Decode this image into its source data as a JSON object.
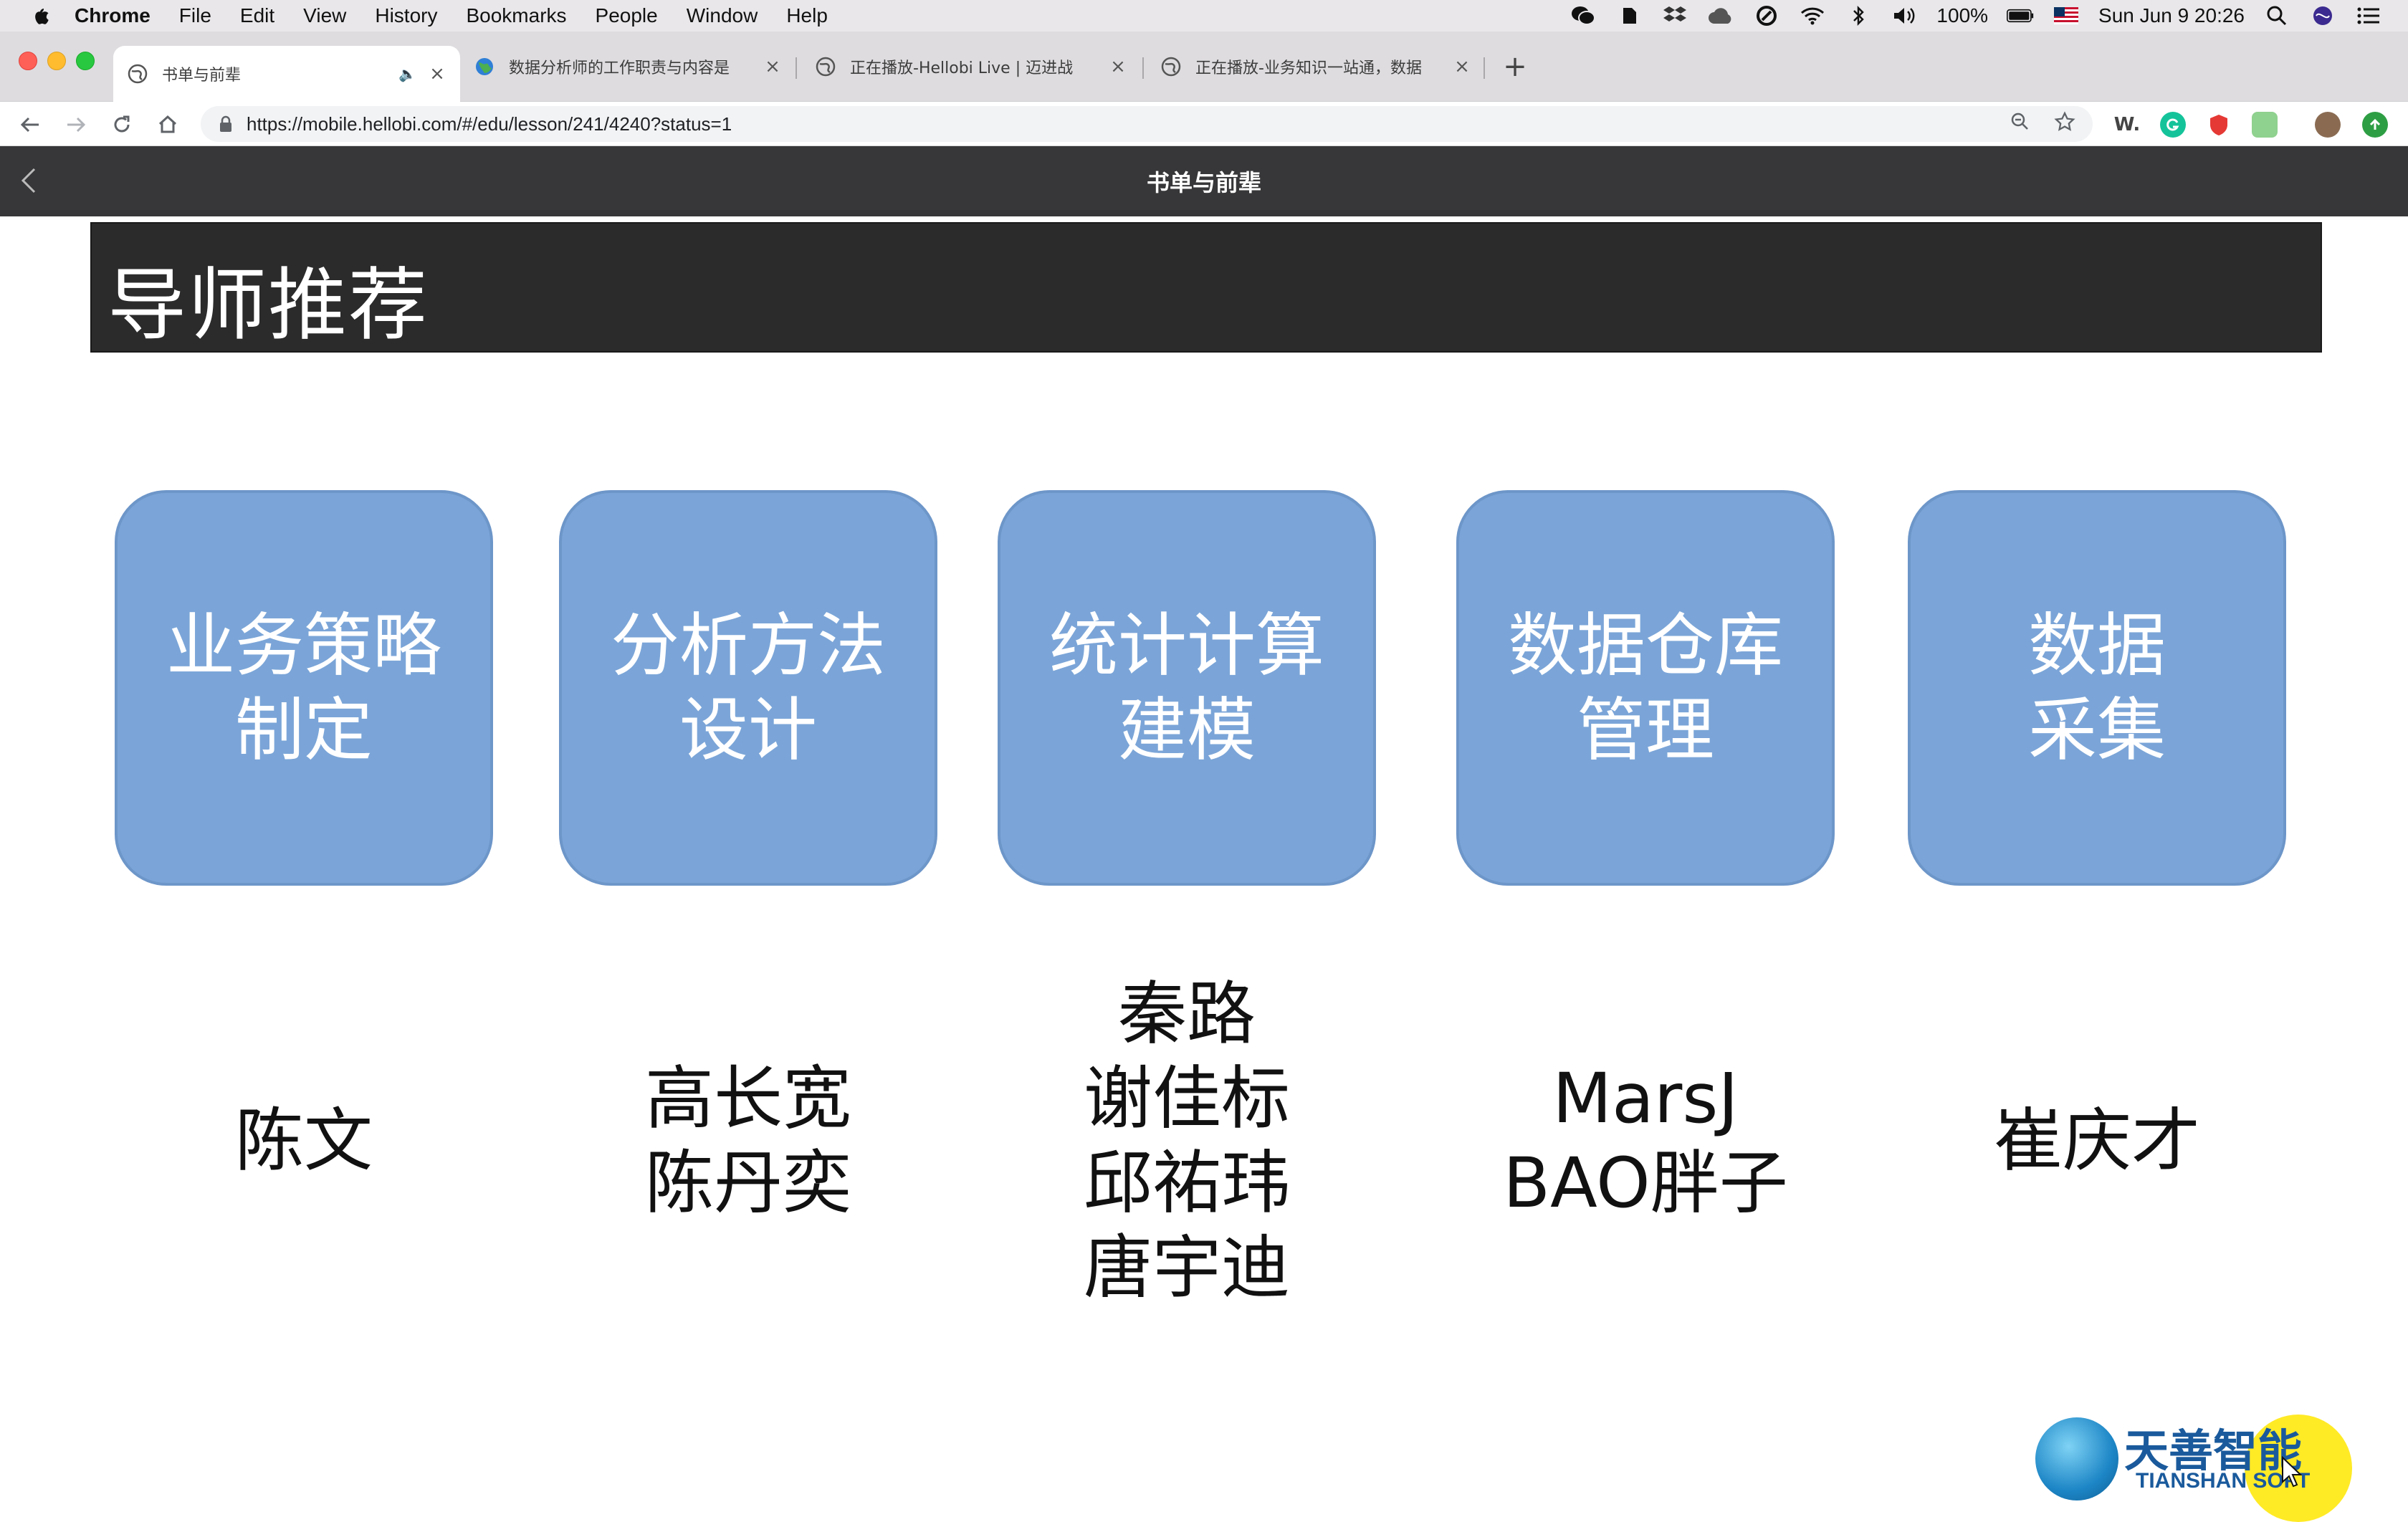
{
  "menubar": {
    "app_name": "Chrome",
    "items": [
      "File",
      "Edit",
      "View",
      "History",
      "Bookmarks",
      "People",
      "Window",
      "Help"
    ],
    "battery": "100%",
    "clock": "Sun Jun 9  20:26"
  },
  "tabs": [
    {
      "title": "书单与前辈",
      "active": true
    },
    {
      "title": "数据分析师的工作职责与内容是",
      "active": false
    },
    {
      "title": "正在播放-Hellobi Live | 迈进战",
      "active": false
    },
    {
      "title": "正在播放-业务知识一站通，数据",
      "active": false
    }
  ],
  "address": {
    "url": "https://mobile.hellobi.com/#/edu/lesson/241/4240?status=1"
  },
  "extensions": {
    "w_label": "W."
  },
  "page": {
    "title": "书单与前辈"
  },
  "slide": {
    "heading": "导师推荐",
    "cards": [
      {
        "label": "业务策略\n制定",
        "names": "陈文"
      },
      {
        "label": "分析方法\n设计",
        "names": "高长宽\n陈丹奕"
      },
      {
        "label": "统计计算\n建模",
        "names": "秦路\n谢佳标\n邱祐玮\n唐宇迪"
      },
      {
        "label": "数据仓库\n管理",
        "names": "MarsJ\nBAO胖子"
      },
      {
        "label": "数据\n采集",
        "names": "崔庆才"
      }
    ],
    "logo": {
      "brand": "天善智能",
      "sub": "TIANSHAN SOFT"
    }
  },
  "colors": {
    "card_fill": "#7ba5d8",
    "header_bg": "#2b2b2b",
    "page_bar": "#373739"
  }
}
